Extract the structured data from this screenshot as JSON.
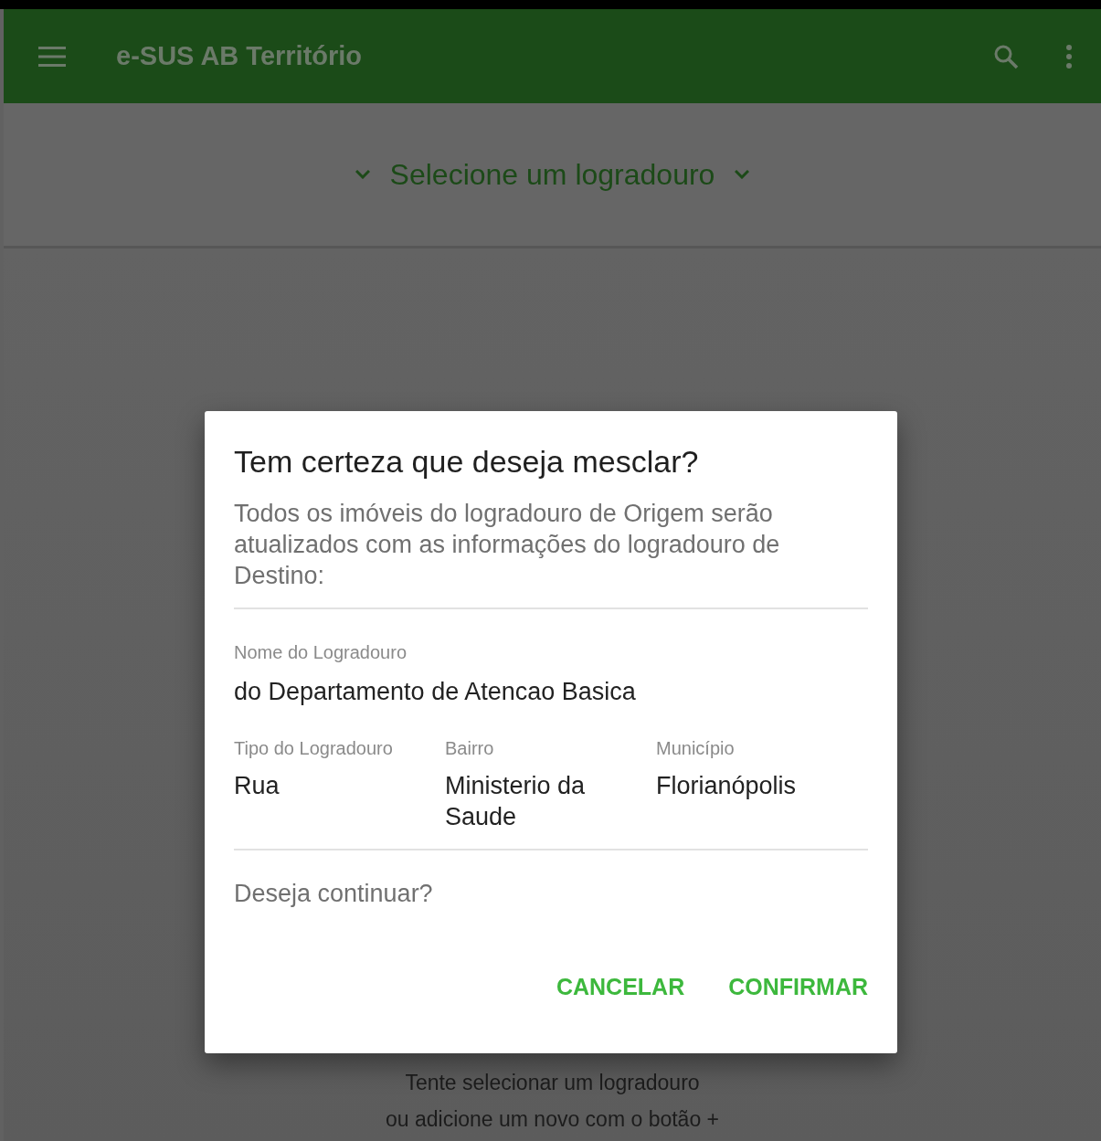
{
  "app_bar": {
    "title": "e-SUS AB Território"
  },
  "selector": {
    "label": "Selecione um logradouro"
  },
  "empty_state": {
    "lines": [
      "Tente selecionar um logradouro",
      "ou adicione um novo com o botão +"
    ]
  },
  "dialog": {
    "title": "Tem certeza que deseja mesclar?",
    "message": "Todos os imóveis do logradouro de Origem serão atualizados com as informações do logradouro de Destino:",
    "main_field": {
      "label": "Nome do Logradouro",
      "value": "do Departamento de Atencao Basica"
    },
    "fields": [
      {
        "label": "Tipo do Logradouro",
        "value": "Rua"
      },
      {
        "label": "Bairro",
        "value": "Ministerio da Saude"
      },
      {
        "label": "Município",
        "value": "Florianópolis"
      }
    ],
    "question": "Deseja continuar?",
    "buttons": [
      "CANCELAR",
      "CONFIRMAR"
    ]
  }
}
